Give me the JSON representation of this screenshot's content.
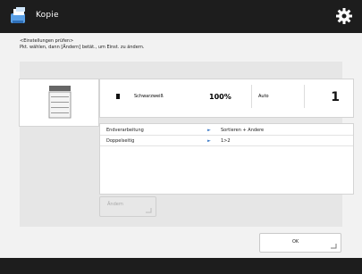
{
  "app": {
    "title": "Kopie"
  },
  "instructions": {
    "line1": "<Einstellungen prüfen>",
    "line2": "Pkt. wählen, dann [Ändern] betät., um Einst. zu ändern."
  },
  "summary": {
    "color_mode": "Schwarzweiß",
    "zoom": "100%",
    "paper": "Auto",
    "copies": "1"
  },
  "settings_list": [
    {
      "label": "Endverarbeitung",
      "value": "Sortieren + Andere"
    },
    {
      "label": "Doppelseitig",
      "value": "1>2"
    }
  ],
  "buttons": {
    "change": "Ändern",
    "ok": "OK"
  },
  "icons": {
    "app": "copy-icon",
    "settings": "gear-icon",
    "arrow": "arrow-right-icon",
    "corner": "corner-mark-icon"
  },
  "colors": {
    "topbar": "#1d1d1d",
    "accent": "#3a78c6",
    "background": "#f2f2f2"
  }
}
